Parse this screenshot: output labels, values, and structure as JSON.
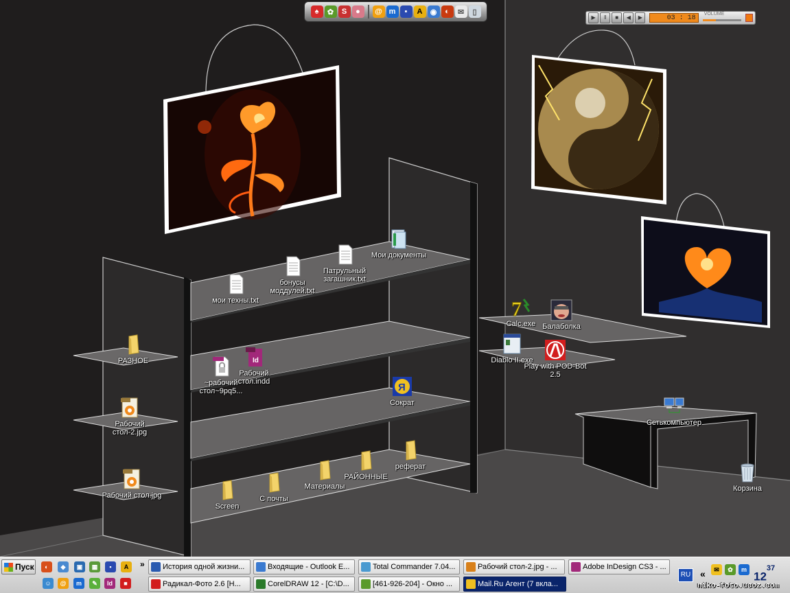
{
  "desktop": {
    "icons": [
      {
        "id": "moi-tehny",
        "label": "мои техны.txt",
        "kind": "txt"
      },
      {
        "id": "bonusy",
        "label": "бонусы моддулей.txt",
        "kind": "txt"
      },
      {
        "id": "patrulny",
        "label": "Патрульный загашник.txt",
        "kind": "txt"
      },
      {
        "id": "moi-docs",
        "label": "Мои документы",
        "kind": "mydocs"
      },
      {
        "id": "raznoe",
        "label": "РАЗНОЕ",
        "kind": "folder"
      },
      {
        "id": "lock",
        "label": "~рабочий стол~9pq5...",
        "kind": "lock"
      },
      {
        "id": "indd",
        "label": "Рабочий стол.indd",
        "kind": "indd"
      },
      {
        "id": "sokrat",
        "label": "Сократ",
        "kind": "sokrat"
      },
      {
        "id": "jpg2",
        "label": "Рабочий стол-2.jpg",
        "kind": "jpg"
      },
      {
        "id": "jpg1",
        "label": "Рабочий стол.jpg",
        "kind": "jpg"
      },
      {
        "id": "screen",
        "label": "Screen",
        "kind": "folder"
      },
      {
        "id": "spochty",
        "label": "С почты",
        "kind": "folder"
      },
      {
        "id": "materialy",
        "label": "Материалы",
        "kind": "folder"
      },
      {
        "id": "rayonnye",
        "label": "РАЙОННЫЕ",
        "kind": "folder"
      },
      {
        "id": "referat",
        "label": "реферат",
        "kind": "folder"
      },
      {
        "id": "calc",
        "label": "Calc.exe",
        "kind": "calc"
      },
      {
        "id": "balabolka",
        "label": "Балаболка",
        "kind": "balabolka"
      },
      {
        "id": "diablo",
        "label": "Diablo II.exe",
        "kind": "diablo"
      },
      {
        "id": "podbot",
        "label": "Play with POD-Bot 2.5",
        "kind": "hl"
      },
      {
        "id": "network",
        "label": "Сетькомпьютер",
        "kind": "network"
      },
      {
        "id": "trash",
        "label": "Корзина",
        "kind": "trash"
      }
    ]
  },
  "player": {
    "time": "03 : 18",
    "volume_label": "VOLUME",
    "volume_level": 0.35
  },
  "taskbar": {
    "start_label": "Пуск",
    "tasks_row1": [
      {
        "label": "История одной жизни...",
        "icon": "word"
      },
      {
        "label": "Входящие - Outlook E...",
        "icon": "outlook"
      },
      {
        "label": "Total Commander 7.04...",
        "icon": "tc"
      },
      {
        "label": "Рабочий стол-2.jpg - ...",
        "icon": "viewer"
      },
      {
        "label": "Adobe InDesign CS3 - ...",
        "icon": "indesign"
      }
    ],
    "tasks_row2": [
      {
        "label": "Радикал-Фото 2.6 [Н...",
        "icon": "radikal"
      },
      {
        "label": "CorelDRAW 12 - [C:\\D...",
        "icon": "corel"
      },
      {
        "label": "[461-926-204] - Окно ...",
        "icon": "icq"
      },
      {
        "label": "Mail.Ru Агент (7 вкла...",
        "icon": "mail",
        "active": true
      }
    ],
    "lang": "RU",
    "chevron": "«",
    "overflow": "»",
    "clock_hour": "12",
    "clock_min": "37",
    "watermark": "niko-foto.ucoz.com"
  },
  "colors": {
    "wall_left": "#1f1d1d",
    "wall_right": "#302e2e",
    "floor": "#4a4848",
    "shelf": "#6c6a6a",
    "accent_orange": "#f08a1c",
    "taskbar_active": "#0a246a"
  }
}
